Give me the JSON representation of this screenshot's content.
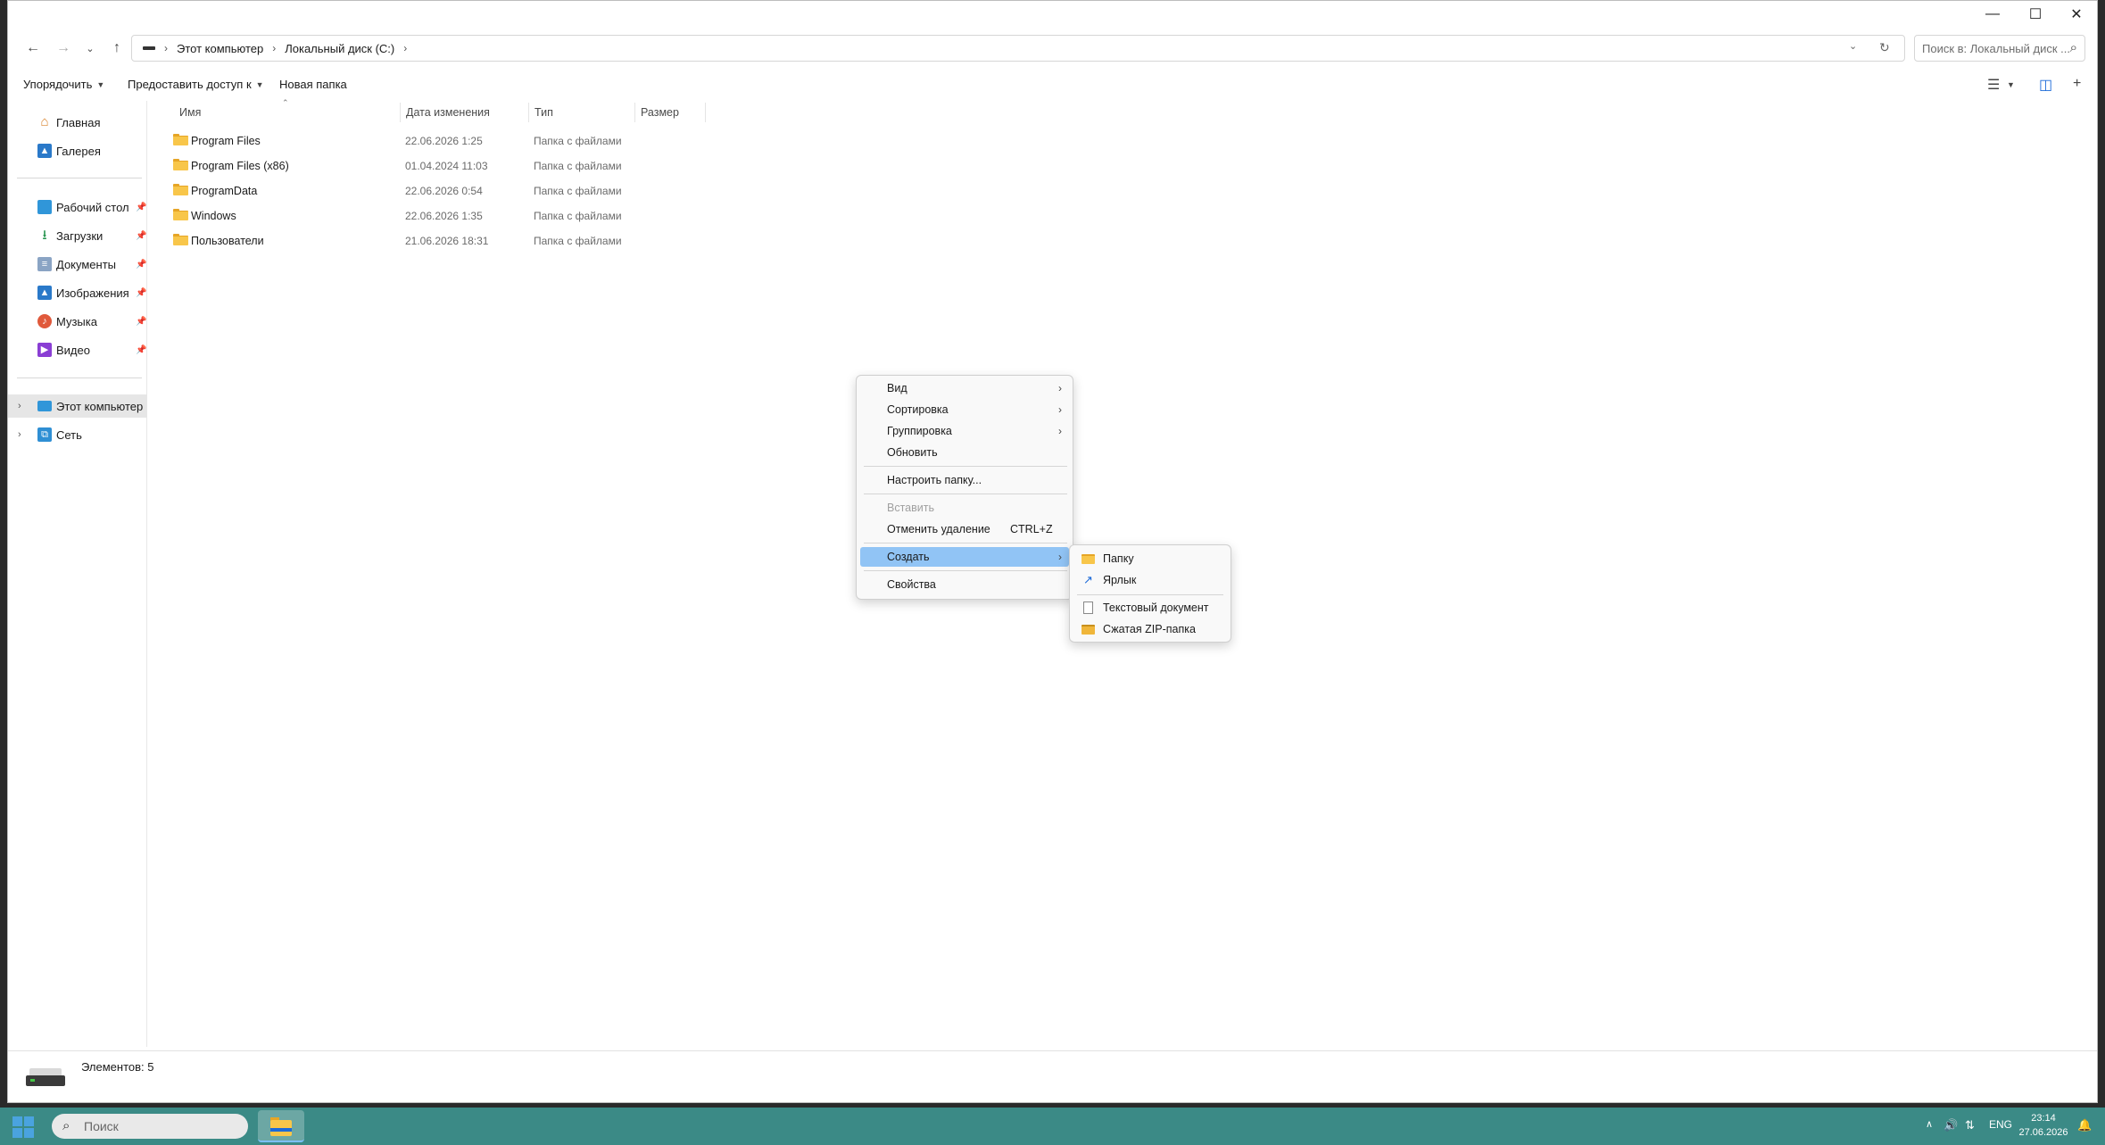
{
  "window": {
    "controls": {
      "minimize": "—",
      "maximize": "☐",
      "close": "✕"
    }
  },
  "address": {
    "crumbs": [
      "Этот компьютер",
      "Локальный диск (C:)"
    ],
    "search_placeholder": "Поиск в: Локальный диск ..."
  },
  "commands": {
    "organize": "Упорядочить",
    "share": "Предоставить доступ к",
    "new_folder": "Новая папка"
  },
  "sidebar": {
    "top": [
      {
        "label": "Главная",
        "icon": "home-icon"
      },
      {
        "label": "Галерея",
        "icon": "gallery-icon"
      }
    ],
    "pinned": [
      {
        "label": "Рабочий стол",
        "icon": "desktop-icon"
      },
      {
        "label": "Загрузки",
        "icon": "downloads-icon"
      },
      {
        "label": "Документы",
        "icon": "documents-icon"
      },
      {
        "label": "Изображения",
        "icon": "pictures-icon"
      },
      {
        "label": "Музыка",
        "icon": "music-icon"
      },
      {
        "label": "Видео",
        "icon": "videos-icon"
      }
    ],
    "tree": [
      {
        "label": "Этот компьютер",
        "icon": "this-pc-icon",
        "selected": true
      },
      {
        "label": "Сеть",
        "icon": "network-icon",
        "selected": false
      }
    ]
  },
  "columns": {
    "name": "Имя",
    "date": "Дата изменения",
    "type": "Тип",
    "size": "Размер"
  },
  "files": [
    {
      "name": "Program Files",
      "date": "22.06.2026 1:25",
      "type": "Папка с файлами"
    },
    {
      "name": "Program Files (x86)",
      "date": "01.04.2024 11:03",
      "type": "Папка с файлами"
    },
    {
      "name": "ProgramData",
      "date": "22.06.2026 0:54",
      "type": "Папка с файлами"
    },
    {
      "name": "Windows",
      "date": "22.06.2026 1:35",
      "type": "Папка с файлами"
    },
    {
      "name": "Пользователи",
      "date": "21.06.2026 18:31",
      "type": "Папка с файлами"
    }
  ],
  "status": {
    "items_count": "Элементов: 5"
  },
  "context_menu": {
    "view": "Вид",
    "sort": "Сортировка",
    "group": "Группировка",
    "refresh": "Обновить",
    "customize": "Настроить папку...",
    "paste": "Вставить",
    "undo_delete": "Отменить удаление",
    "undo_shortcut": "CTRL+Z",
    "new": "Создать",
    "properties": "Свойства"
  },
  "submenu": {
    "folder": "Папку",
    "shortcut": "Ярлык",
    "text_doc": "Текстовый документ",
    "zip": "Сжатая ZIP-папка"
  },
  "taskbar": {
    "search_placeholder": "Поиск",
    "lang": "ENG",
    "time": "23:14",
    "date": "27.06.2026"
  },
  "colors": {
    "accent": "#91c4f5",
    "taskbar": "#3b8a86",
    "folder": "#f8c64a"
  }
}
